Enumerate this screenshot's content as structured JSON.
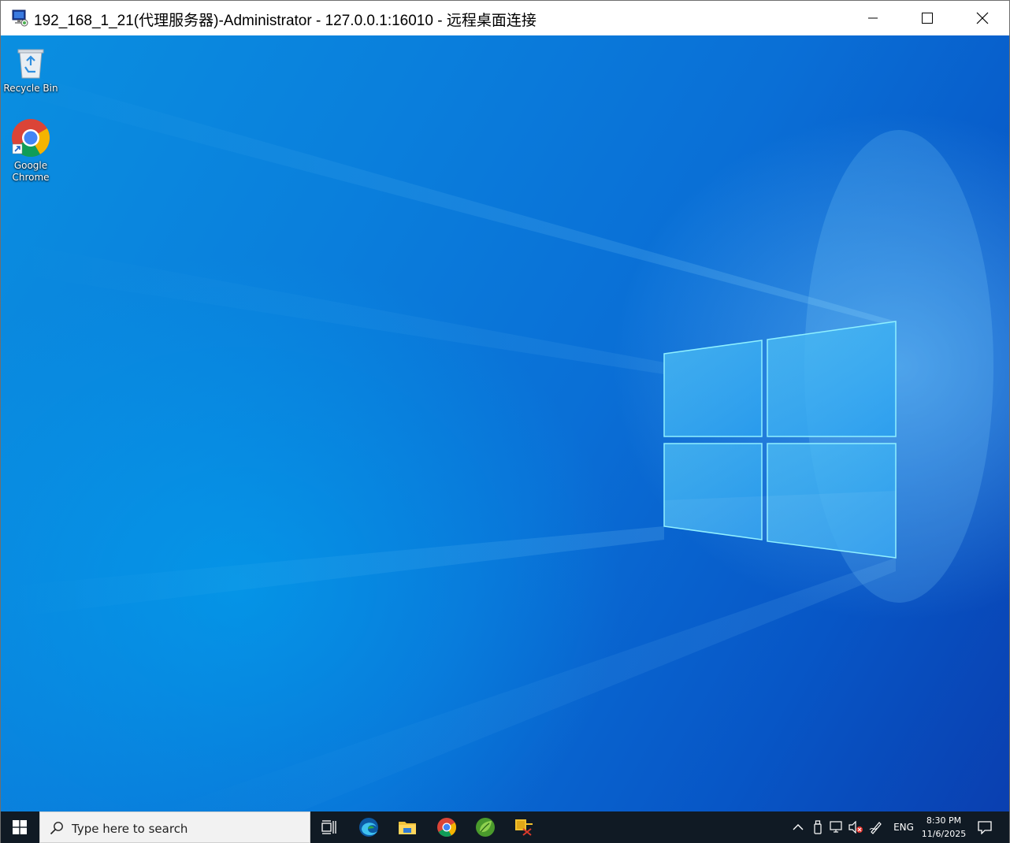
{
  "window": {
    "title": "192_168_1_21(代理服务器)-Administrator - 127.0.0.1:16010 - 远程桌面连接",
    "buttons": [
      "minimize-icon",
      "maximize-icon",
      "close-icon"
    ]
  },
  "desktop": {
    "icons": [
      {
        "label": "Recycle Bin",
        "icon": "recycle-bin-icon"
      },
      {
        "label_line1": "Google",
        "label_line2": "Chrome",
        "icon": "chrome-icon"
      }
    ]
  },
  "taskbar": {
    "search_placeholder": "Type here to search",
    "pinned": [
      "task-view-icon",
      "edge-icon",
      "file-explorer-icon",
      "chrome-icon",
      "spring-app-icon",
      "network-tool-icon"
    ],
    "tray": {
      "language": "ENG",
      "time": "8:30 PM",
      "date": "11/6/2025"
    }
  },
  "colors": {
    "taskbar_bg": "#101a24",
    "desktop_accent": "#0a7fdc"
  }
}
